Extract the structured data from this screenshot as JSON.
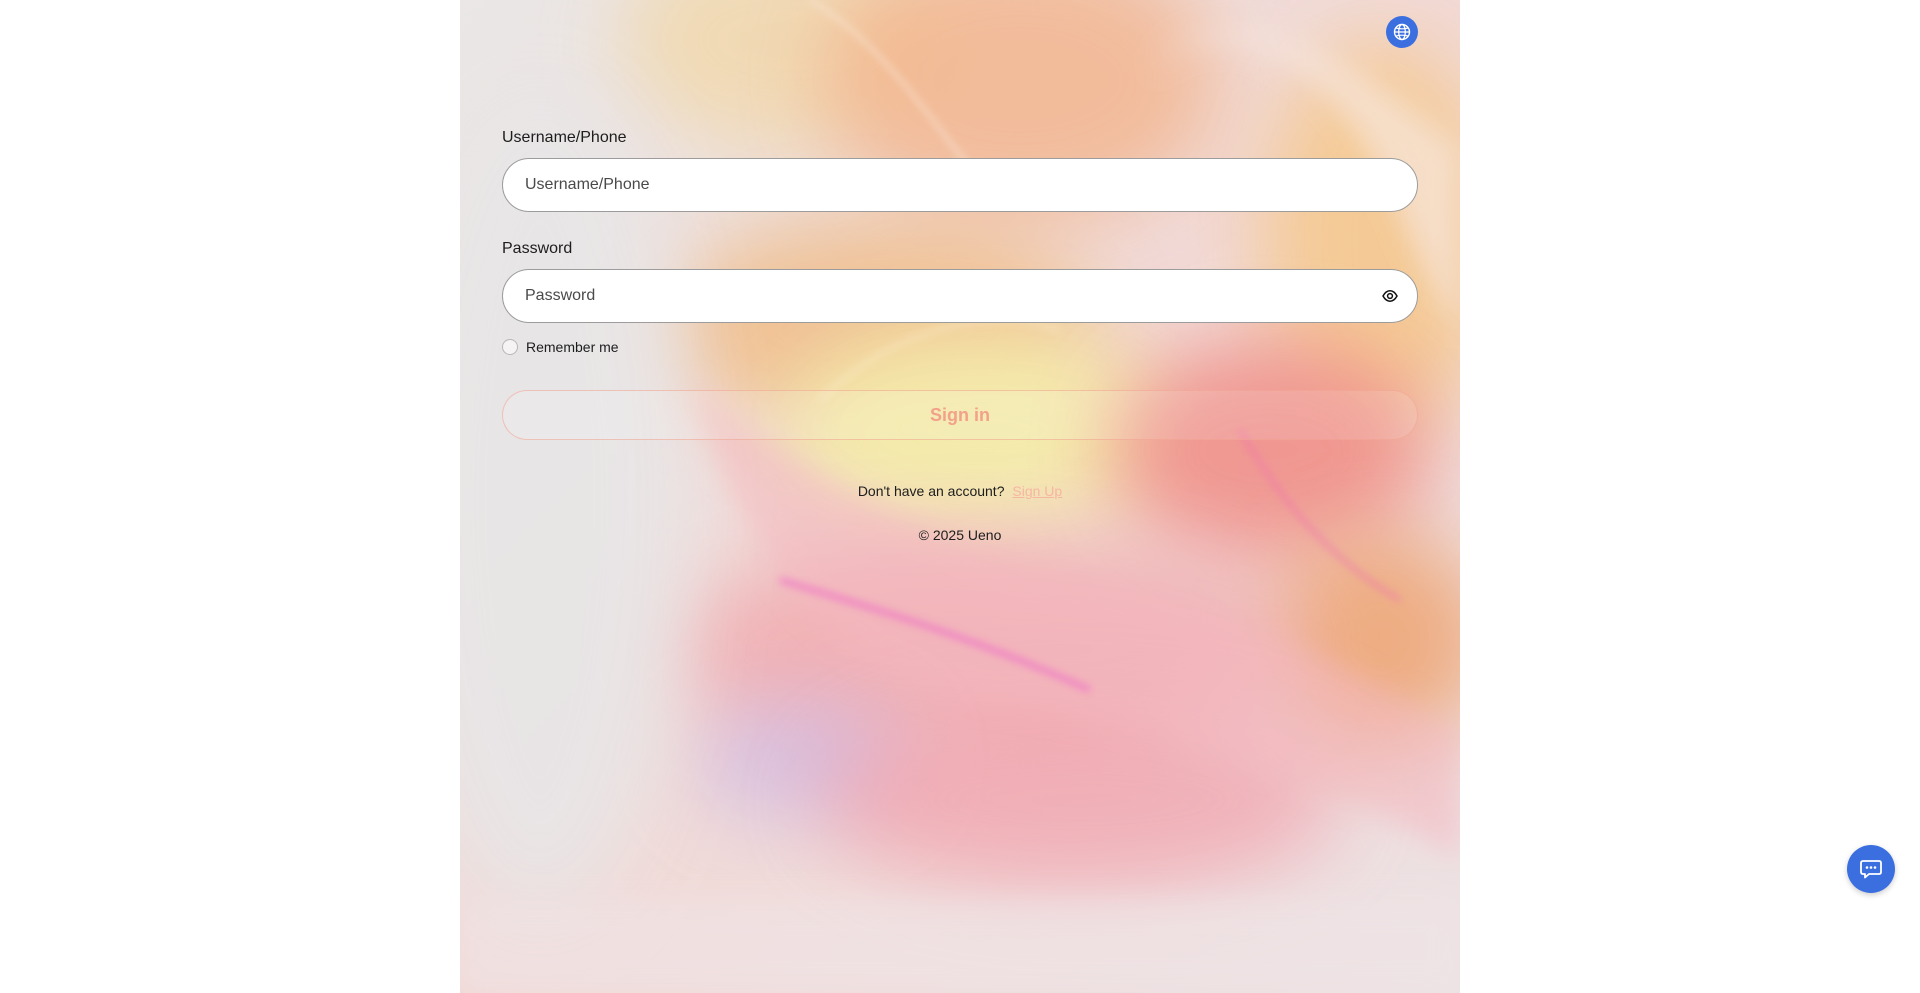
{
  "header": {
    "language_icon": "globe-icon"
  },
  "login_form": {
    "username": {
      "label": "Username/Phone",
      "placeholder": "Username/Phone",
      "value": ""
    },
    "password": {
      "label": "Password",
      "placeholder": "Password",
      "value": "",
      "toggle_icon": "eye-icon"
    },
    "remember_me": {
      "label": "Remember me",
      "checked": false
    },
    "signin_label": "Sign in"
  },
  "signup": {
    "prompt": "Don't have an account?",
    "link_label": "Sign Up"
  },
  "footer": {
    "copyright": "© 2025 Ueno"
  },
  "support": {
    "chat_icon": "chat-bubble-icon"
  },
  "colors": {
    "accent_blue": "#3b6fe0",
    "signin_text": "#f2a18a",
    "signup_link": "#f6b6a4",
    "panel_bg": "#e9e6e6"
  }
}
